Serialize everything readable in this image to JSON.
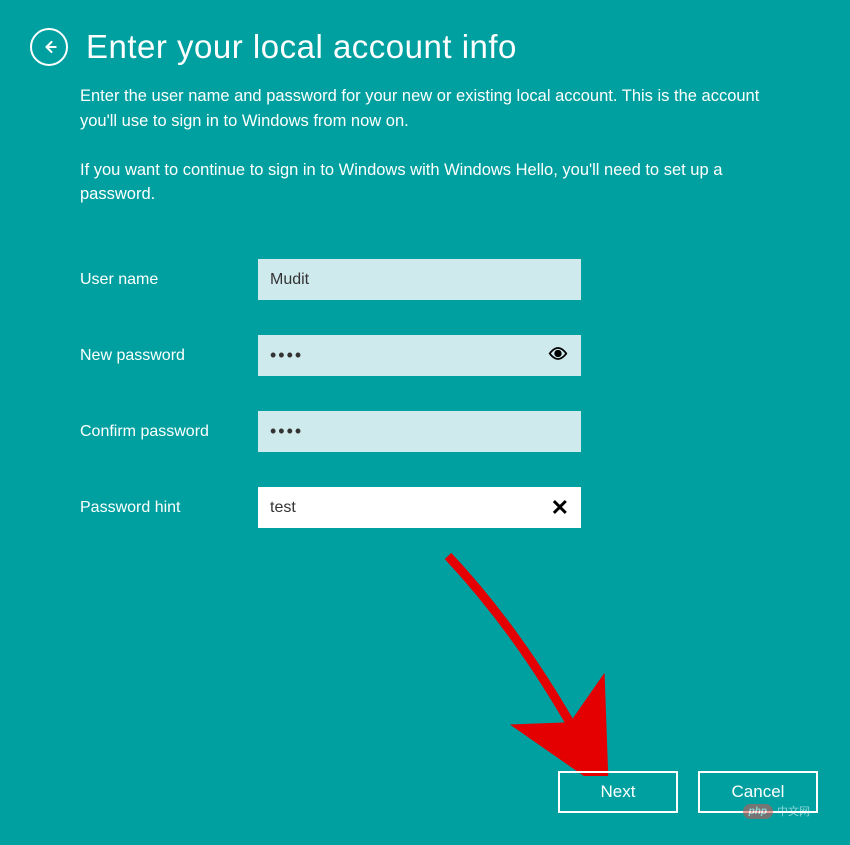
{
  "header": {
    "title": "Enter your local account info"
  },
  "description": {
    "line1": "Enter the user name and password for your new or existing local account. This is the account you'll use to sign in to Windows from now on.",
    "line2": "If you want to continue to sign in to Windows with Windows Hello, you'll need to set up a password."
  },
  "form": {
    "username": {
      "label": "User name",
      "value": "Mudit"
    },
    "new_password": {
      "label": "New password",
      "value": "••••"
    },
    "confirm_password": {
      "label": "Confirm password",
      "value": "••••"
    },
    "password_hint": {
      "label": "Password hint",
      "value": "test"
    }
  },
  "buttons": {
    "next": "Next",
    "cancel": "Cancel"
  },
  "watermark": {
    "badge": "php",
    "text": "中文网"
  }
}
